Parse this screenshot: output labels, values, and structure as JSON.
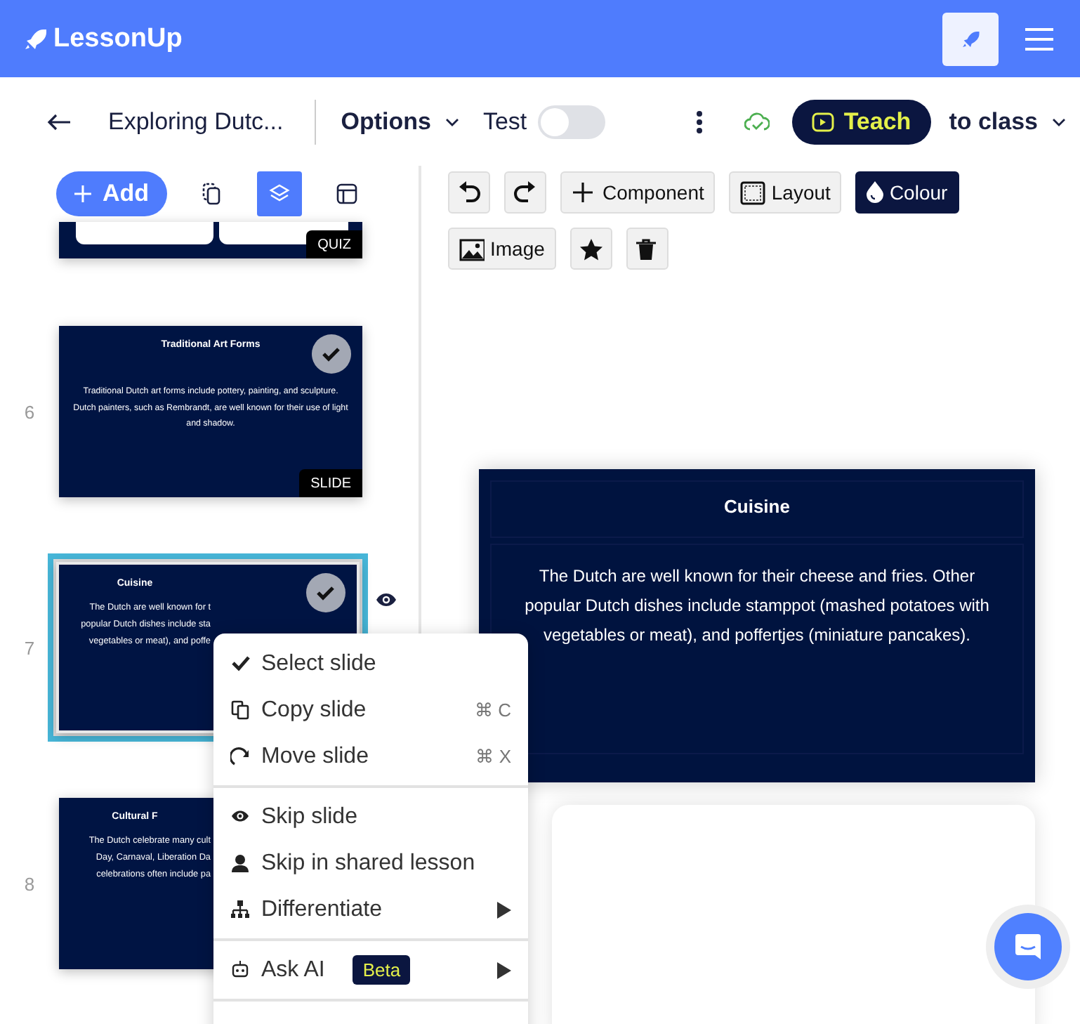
{
  "app": {
    "name": "LessonUp"
  },
  "toolbar": {
    "title": "Exploring Dutc...",
    "options": "Options",
    "test": {
      "label": "Test",
      "on": false
    },
    "teach": "Teach",
    "to_class": "to class"
  },
  "sidebar": {
    "add": "Add",
    "view_modes": [
      {
        "kind": "copy",
        "selected": false
      },
      {
        "kind": "layers",
        "selected": true
      },
      {
        "kind": "layout",
        "selected": false
      }
    ],
    "slides": [
      {
        "kind": "quiz_cropped",
        "tag": "QUIZ"
      },
      {
        "kind": "full",
        "number": "6",
        "title": "Traditional Art Forms",
        "body": "Traditional Dutch art forms include pottery, painting, and sculpture. Dutch painters, such as Rembrandt, are well known for their use of light and shadow.",
        "tag": "SLIDE",
        "checkmark": true,
        "selected": false,
        "eye": false
      },
      {
        "kind": "covered",
        "number": "7",
        "title": "Cuisine",
        "lines": [
          "The Dutch are well known for t",
          "popular Dutch dishes include sta",
          "vegetables or meat), and poffe"
        ],
        "checkmark": true,
        "selected": true,
        "eye": true
      },
      {
        "kind": "covered",
        "number": "8",
        "title": "Cultural F",
        "lines": [
          "The Dutch celebrate many cult",
          "Day, Carnaval, Liberation Da",
          "celebrations often include pa"
        ],
        "checkmark": false,
        "selected": false,
        "eye": false
      }
    ]
  },
  "editor": {
    "tools": [
      {
        "kind": "undo",
        "selected": false
      },
      {
        "kind": "redo",
        "selected": false
      },
      {
        "kind": "component",
        "label": "Component",
        "selected": false
      },
      {
        "kind": "layout",
        "label": "Layout",
        "selected": false
      },
      {
        "kind": "colour",
        "label": "Colour",
        "selected": true
      },
      {
        "kind": "image",
        "label": "Image",
        "selected": false
      },
      {
        "kind": "star",
        "selected": false
      },
      {
        "kind": "trash",
        "selected": false
      }
    ],
    "slide": {
      "title": "Cuisine",
      "body": "The Dutch are well known for their cheese and fries. Other popular Dutch dishes include stamppot (mashed potatoes with vegetables or meat), and poffertjes (miniature pancakes)."
    }
  },
  "context_menu": {
    "groups": [
      [
        {
          "kind": "select",
          "label": "Select slide",
          "submenu": false
        },
        {
          "kind": "copy",
          "label": "Copy slide",
          "shortcut": "⌘ C",
          "submenu": false
        },
        {
          "kind": "move",
          "label": "Move slide",
          "shortcut": "⌘ X",
          "submenu": false
        }
      ],
      [
        {
          "kind": "skip",
          "label": "Skip slide",
          "submenu": false
        },
        {
          "kind": "skip_shared",
          "label": "Skip in shared lesson",
          "submenu": false
        },
        {
          "kind": "differentiate",
          "label": "Differentiate",
          "submenu": true
        }
      ],
      [
        {
          "kind": "ask_ai",
          "label": "Ask AI",
          "badge": "Beta",
          "submenu": true
        }
      ]
    ]
  }
}
